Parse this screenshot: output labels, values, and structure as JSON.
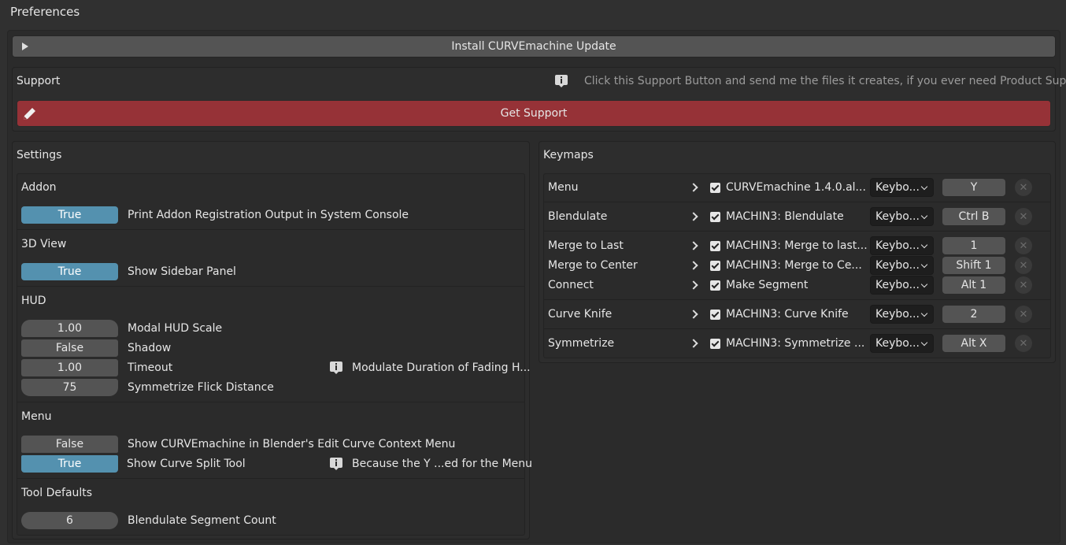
{
  "window": {
    "title": "Preferences"
  },
  "install": {
    "label": "Install CURVEmachine Update"
  },
  "support": {
    "heading": "Support",
    "hint": "Click this Support Button and send me the files it creates, if you ever need Product Support",
    "button_label": "Get Support",
    "button_color": "#963237"
  },
  "settings": {
    "heading": "Settings",
    "addon": {
      "heading": "Addon",
      "print_registration": {
        "value": "True",
        "label": "Print Addon Registration Output in System Console"
      }
    },
    "view3d": {
      "heading": "3D View",
      "sidebar": {
        "value": "True",
        "label": "Show Sidebar Panel"
      }
    },
    "hud": {
      "heading": "HUD",
      "scale": {
        "value": "1.00",
        "label": "Modal HUD Scale"
      },
      "shadow": {
        "value": "False",
        "label": "Shadow"
      },
      "timeout": {
        "value": "1.00",
        "label": "Timeout",
        "hint": "Modulate Duration of Fading H..."
      },
      "flick": {
        "value": "75",
        "label": "Symmetrize Flick Distance"
      }
    },
    "menu": {
      "heading": "Menu",
      "context": {
        "value": "False",
        "label": "Show CURVEmachine in Blender's Edit Curve Context Menu"
      },
      "split": {
        "value": "True",
        "label": "Show Curve Split Tool",
        "hint": "Because the Y ...ed for the Menu"
      }
    },
    "tools": {
      "heading": "Tool Defaults",
      "segments": {
        "value": "6",
        "label": "Blendulate Segment Count"
      }
    },
    "toggle_on_color": "#5491af"
  },
  "keymaps": {
    "heading": "Keymaps",
    "rows": [
      {
        "name": "Menu",
        "op": "CURVEmachine 1.4.0.al...",
        "type": "Keybo...",
        "key": "Y"
      },
      {
        "name": "Blendulate",
        "op": "MACHIN3: Blendulate",
        "type": "Keybo...",
        "key": "Ctrl B"
      },
      {
        "name": "Merge to Last",
        "op": "MACHIN3: Merge to last...",
        "type": "Keybo...",
        "key": "1"
      },
      {
        "name": "Merge to Center",
        "op": "MACHIN3: Merge to Ce...",
        "type": "Keybo...",
        "key": "Shift 1"
      },
      {
        "name": "Connect",
        "op": "Make Segment",
        "type": "Keybo...",
        "key": "Alt 1"
      },
      {
        "name": "Curve Knife",
        "op": "MACHIN3: Curve Knife",
        "type": "Keybo...",
        "key": "2"
      },
      {
        "name": "Symmetrize",
        "op": "MACHIN3: Symmetrize ...",
        "type": "Keybo...",
        "key": "Alt X"
      }
    ]
  }
}
